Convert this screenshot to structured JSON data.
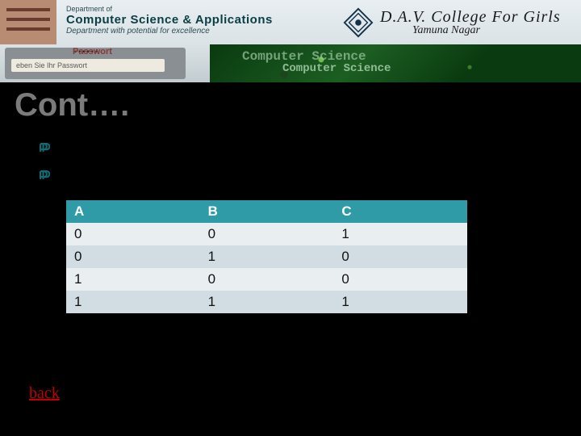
{
  "banner": {
    "dept_small": "Department of",
    "dept_main": "Computer Science & Applications",
    "dept_sub": "Department with potential for excellence",
    "college_main": "D.A.V. College For Girls",
    "college_sub": "Yamuna Nagar",
    "pw_label": "Passwort",
    "pw_hint": "eben Sie Ihr Passwort",
    "pcb_text1": "Computer Science",
    "pcb_text2": "Computer Science"
  },
  "title": "Cont….",
  "table": {
    "headers": [
      "A",
      "B",
      "C"
    ],
    "rows": [
      [
        "0",
        "0",
        "1"
      ],
      [
        "0",
        "1",
        "0"
      ],
      [
        "1",
        "0",
        "0"
      ],
      [
        "1",
        "1",
        "1"
      ]
    ]
  },
  "back_link": "back",
  "chart_data": {
    "type": "table",
    "title": "Cont….",
    "headers": [
      "A",
      "B",
      "C"
    ],
    "rows": [
      [
        0,
        0,
        1
      ],
      [
        0,
        1,
        0
      ],
      [
        1,
        0,
        0
      ],
      [
        1,
        1,
        1
      ]
    ]
  }
}
